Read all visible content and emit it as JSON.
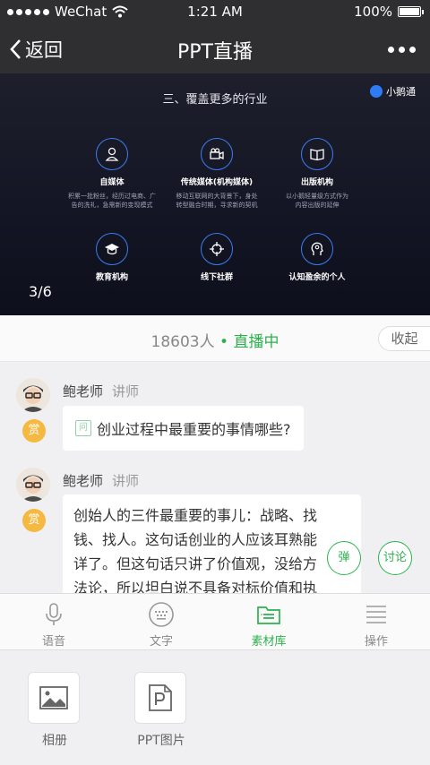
{
  "status_bar": {
    "carrier": "WeChat",
    "time": "1:21 AM",
    "battery": "100%"
  },
  "nav": {
    "back_label": "返回",
    "title": "PPT直播"
  },
  "slide": {
    "title": "三、覆盖更多的行业",
    "brand": "小鹅通",
    "pager": "3/6",
    "items": [
      {
        "label": "自媒体",
        "desc1": "积累一批粉丝，经历过电商、广",
        "desc2": "告的洗礼，急需新的变现模式",
        "icon": "user-icon"
      },
      {
        "label": "传统媒体(机构媒体)",
        "desc1": "移动互联网的大背景下，身处",
        "desc2": "转型融合时期，寻求新的契机",
        "icon": "video-camera-icon"
      },
      {
        "label": "出版机构",
        "desc1": "以小鹅轻量级方式作为",
        "desc2": "内容出版的延伸",
        "icon": "book-icon"
      },
      {
        "label": "教育机构",
        "desc1": "",
        "desc2": "",
        "icon": "graduation-cap-icon"
      },
      {
        "label": "线下社群",
        "desc1": "",
        "desc2": "",
        "icon": "crosshair-icon"
      },
      {
        "label": "认知盈余的个人",
        "desc1": "",
        "desc2": "",
        "icon": "idea-head-icon"
      }
    ]
  },
  "live": {
    "count": "18603人",
    "separator": "•",
    "status": "直播中",
    "collapse_label": "收起"
  },
  "messages": [
    {
      "sender": "鲍老师",
      "role": "讲师",
      "reward": "赏",
      "question_icon": "问",
      "text": "创业过程中最重要的事情哪些?"
    },
    {
      "sender": "鲍老师",
      "role": "讲师",
      "reward": "赏",
      "lines": [
        "创始人的三件最重要的事儿：战略、找",
        "钱、找人。这句话创业的人应该耳熟能",
        "详了。但这句话只讲了价值观，没给方",
        "法论，所以坦白说不具备对标价值和执"
      ]
    }
  ],
  "float_buttons": {
    "danmu": "弹",
    "discuss": "讨论"
  },
  "tabs": [
    {
      "label": "语音",
      "icon": "microphone-icon"
    },
    {
      "label": "文字",
      "icon": "keyboard-icon"
    },
    {
      "label": "素材库",
      "icon": "material-library-icon",
      "active": true
    },
    {
      "label": "操作",
      "icon": "menu-list-icon"
    }
  ],
  "panel": [
    {
      "label": "相册",
      "icon": "photo-album-icon"
    },
    {
      "label": "PPT图片",
      "icon": "ppt-image-icon"
    }
  ],
  "colors": {
    "accent_green": "#2bb24c",
    "reward_orange": "#f5b942",
    "slide_blue": "#3c7cf0",
    "dark_bar": "#2f2f31"
  }
}
